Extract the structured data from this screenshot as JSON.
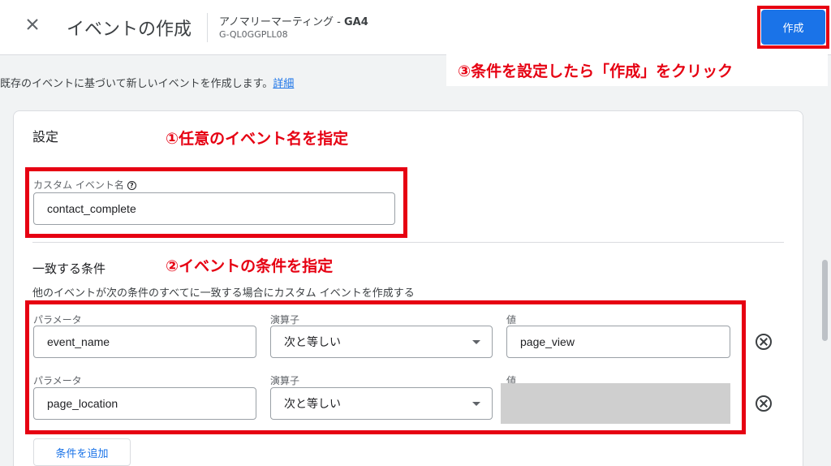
{
  "header": {
    "close_glyph": "✕",
    "title": "イベントの作成",
    "property_name": "アノマリーマーティング - ",
    "property_suffix": "GA4",
    "property_id": "G-QL0GGPLL08",
    "create_label": "作成"
  },
  "annotations": {
    "step3": "③条件を設定したら「作成」をクリック",
    "step1": "①任意のイベント名を指定",
    "step2": "②イベントの条件を指定"
  },
  "description": {
    "text": "既存のイベントに基づいて新しいイベントを作成します。",
    "link": "詳細"
  },
  "settings": {
    "title": "設定",
    "custom_event_label": "カスタム イベント名",
    "help_glyph": "?",
    "custom_event_value": "contact_complete"
  },
  "conditions": {
    "title": "一致する条件",
    "subtitle": "他のイベントが次の条件のすべてに一致する場合にカスタム イベントを作成する",
    "rows": [
      {
        "param_label": "パラメータ",
        "param_value": "event_name",
        "op_label": "演算子",
        "op_value": "次と等しい",
        "val_label": "値",
        "val_value": "page_view"
      },
      {
        "param_label": "パラメータ",
        "param_value": "page_location",
        "op_label": "演算子",
        "op_value": "次と等しい",
        "val_label": "値",
        "val_value": ""
      }
    ],
    "add_label": "条件を追加"
  },
  "colors": {
    "accent": "#1a73e8",
    "annotation_red": "#e60012"
  }
}
